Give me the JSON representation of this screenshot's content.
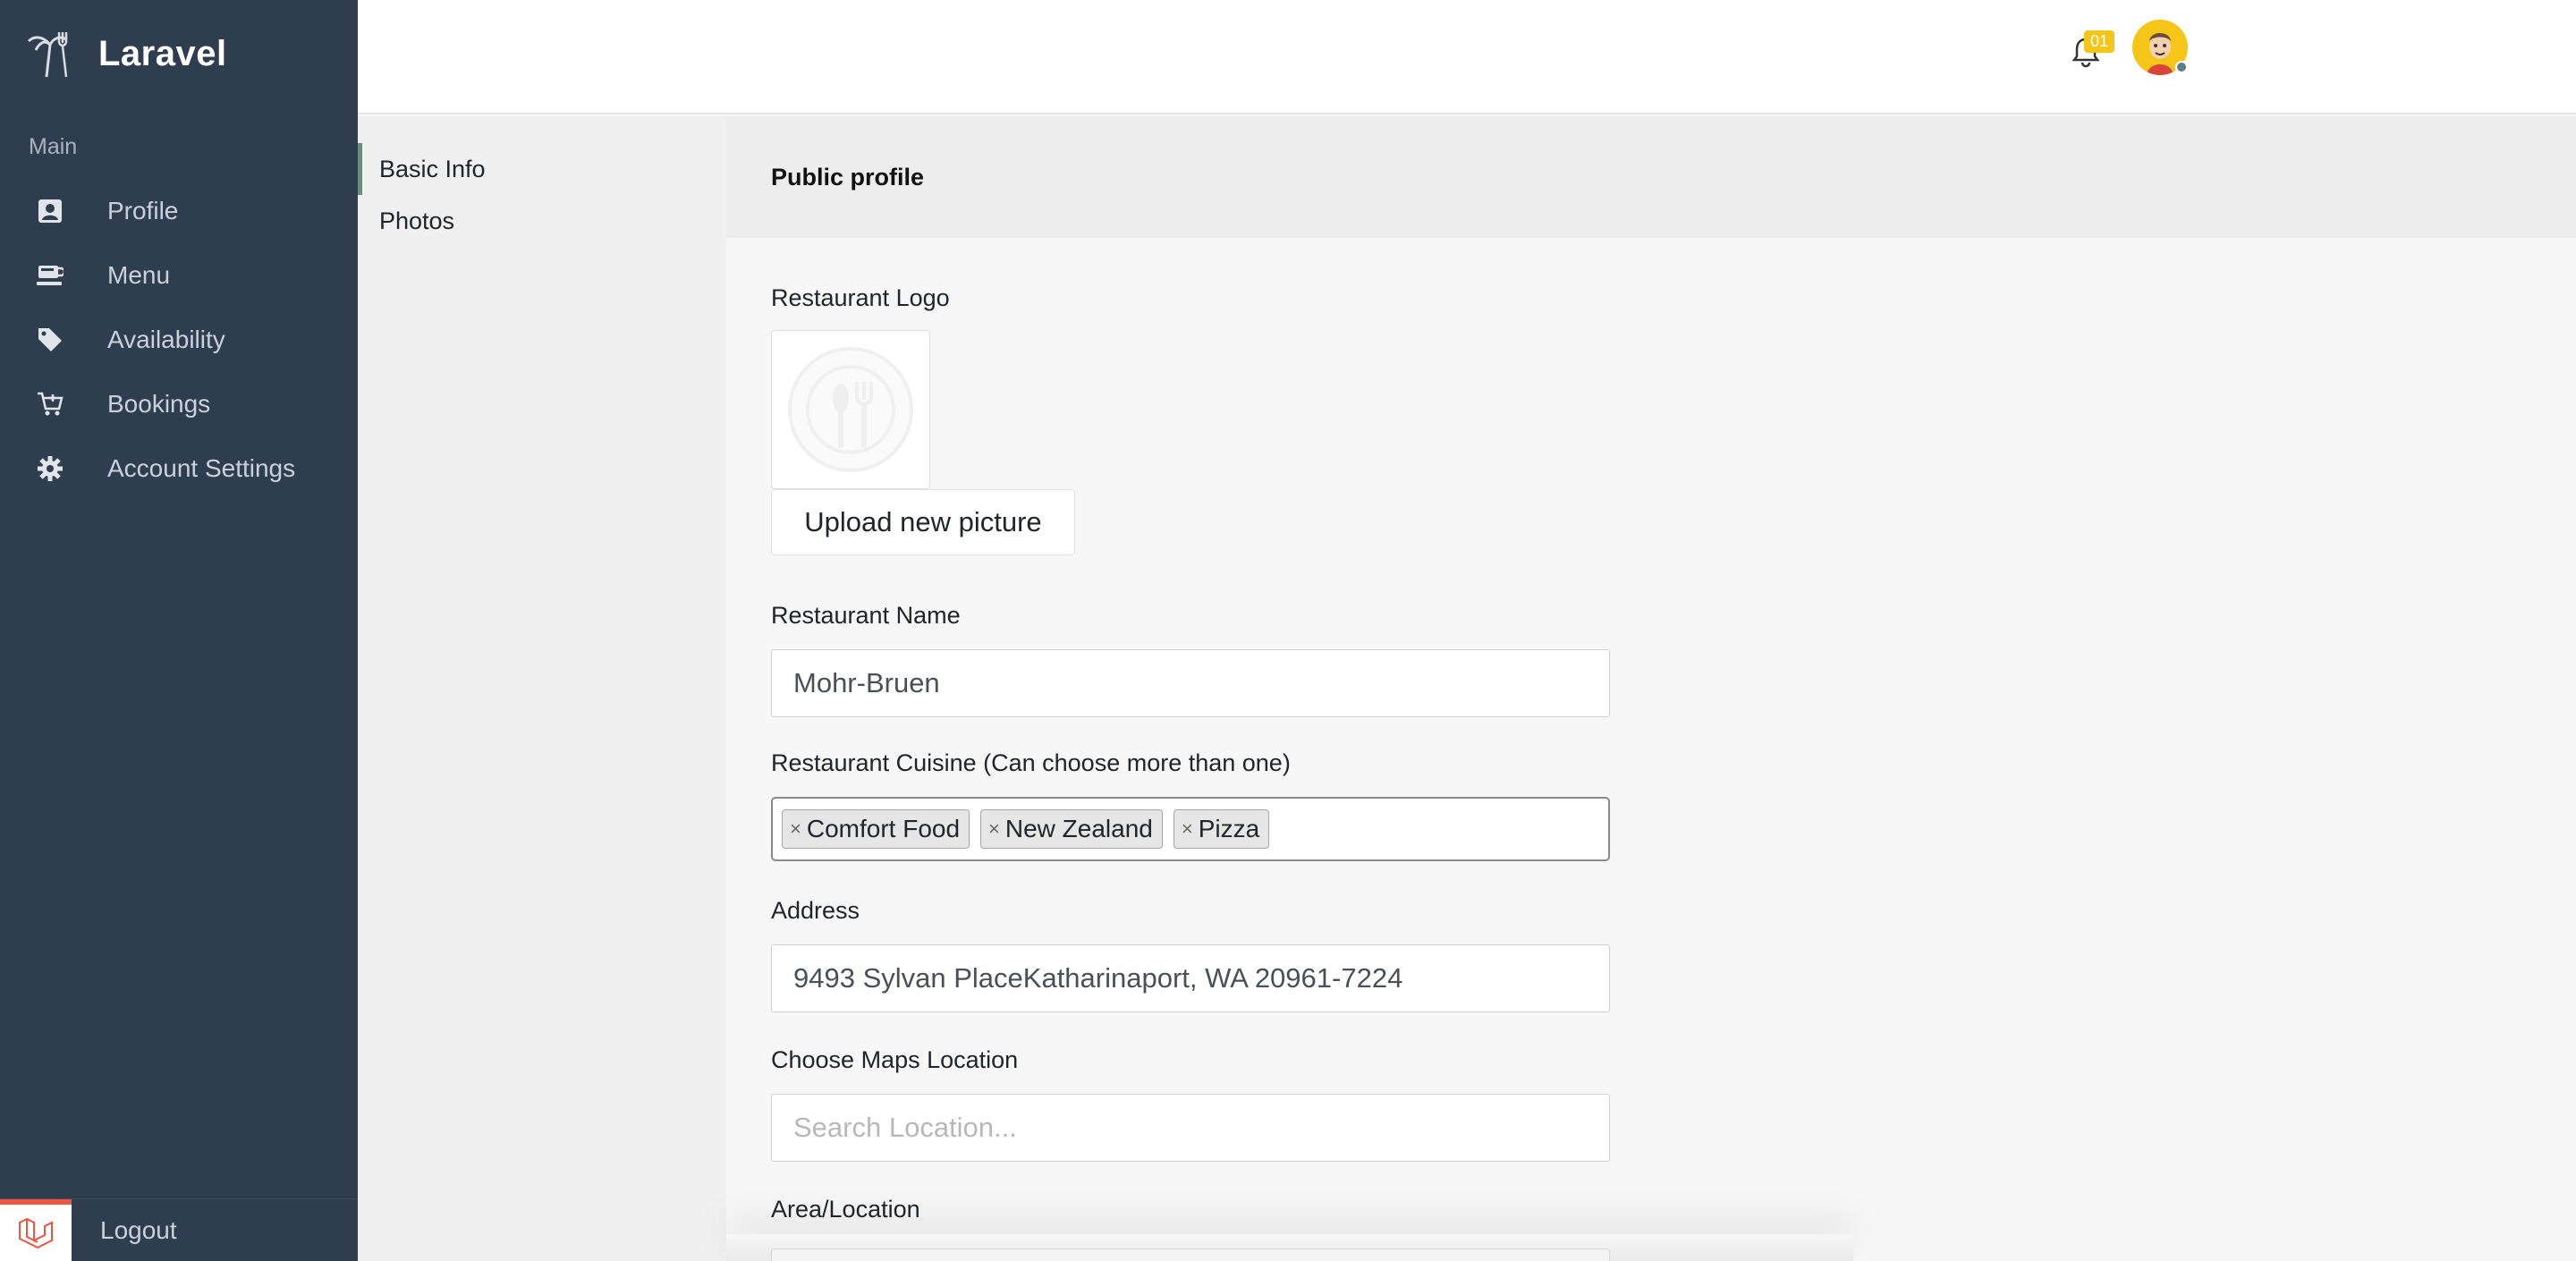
{
  "brand": {
    "name": "Laravel"
  },
  "sidebar": {
    "section_label": "Main",
    "items": [
      {
        "label": "Profile",
        "icon": "contact-card-icon"
      },
      {
        "label": "Menu",
        "icon": "coffee-cup-icon"
      },
      {
        "label": "Availability",
        "icon": "tags-icon"
      },
      {
        "label": "Bookings",
        "icon": "cart-icon"
      },
      {
        "label": "Account Settings",
        "icon": "gear-icon"
      }
    ],
    "logout_label": "Logout"
  },
  "topbar": {
    "notification_count": "01"
  },
  "subnav": {
    "items": [
      {
        "label": "Basic Info"
      },
      {
        "label": "Photos"
      }
    ]
  },
  "panel": {
    "title": "Public profile"
  },
  "form": {
    "logo_label": "Restaurant Logo",
    "upload_label": "Upload new picture",
    "name_label": "Restaurant Name",
    "name_value": "Mohr-Bruen",
    "cuisine_label": "Restaurant Cuisine (Can choose more than one)",
    "cuisine_tags": [
      "Comfort Food",
      "New Zealand",
      "Pizza"
    ],
    "tag_remove_glyph": "×",
    "address_label": "Address",
    "address_value": "9493 Sylvan PlaceKatharinaport, WA 20961-7224",
    "maps_label": "Choose Maps Location",
    "maps_placeholder": "Search Location...",
    "area_label": "Area/Location"
  },
  "colors": {
    "sidebar_bg": "#2f3e4e",
    "badge": "#f5c518",
    "laravel_red": "#f05340"
  }
}
